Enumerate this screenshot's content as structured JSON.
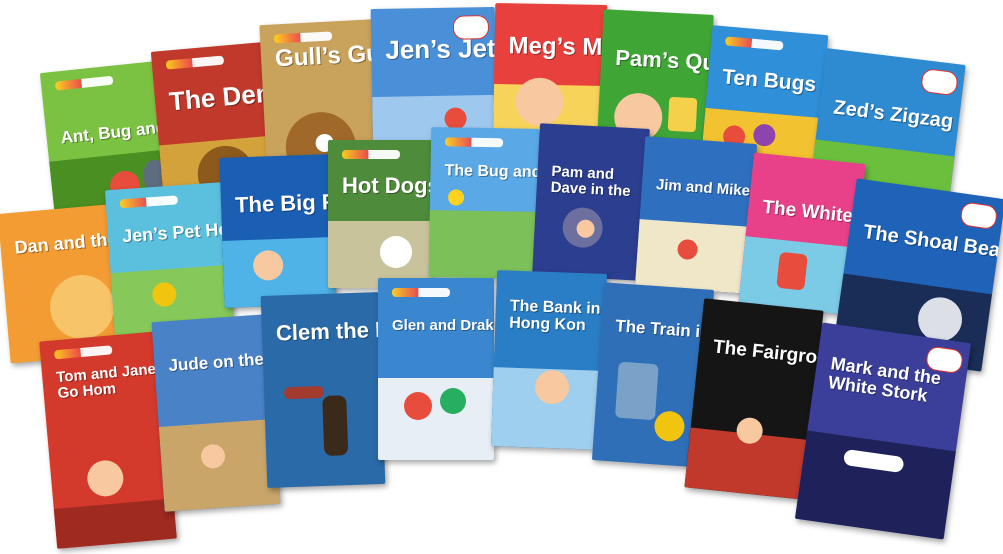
{
  "books": [
    {
      "key": "ant-bug",
      "title": "Ant, Bug and C",
      "bg": "#7cc242",
      "accent": "#4a8f21"
    },
    {
      "key": "the-den",
      "title": "The Den",
      "bg": "#c0392b",
      "accent": "#8d2a1e"
    },
    {
      "key": "gulls-gum",
      "title": "Gull’s Gu",
      "bg": "#c9a25c",
      "accent": "#8e6a31"
    },
    {
      "key": "jens-jet",
      "title": "Jen’s Jet",
      "bg": "#4a90d9",
      "accent": "#9fc8ee"
    },
    {
      "key": "megs-map",
      "title": "Meg’s Ma",
      "bg": "#e8403c",
      "accent": "#f7d35a"
    },
    {
      "key": "pams-quiz",
      "title": "Pam’s Qui",
      "bg": "#3fa535",
      "accent": "#f5d04a"
    },
    {
      "key": "ten-bugs",
      "title": "Ten Bugs",
      "bg": "#2f8fd8",
      "accent": "#f2c230"
    },
    {
      "key": "zeds-zigzag",
      "title": "Zed’s Zigzag",
      "bg": "#2e8bd2",
      "accent": "#6bbf3c"
    },
    {
      "key": "dan-and-the",
      "title": "Dan and the R",
      "bg": "#f39c33",
      "accent": "#f7c46a"
    },
    {
      "key": "jens-pet",
      "title": "Jen’s Pet He",
      "bg": "#5bc0de",
      "accent": "#86c95a"
    },
    {
      "key": "the-big-fish",
      "title": "The Big Fi",
      "bg": "#1b5fb4",
      "accent": "#4fb3e8"
    },
    {
      "key": "hot-dogs",
      "title": "Hot Dogs",
      "bg": "#4e8b3a",
      "accent": "#c8c39a"
    },
    {
      "key": "the-bug-and",
      "title": "The Bug and the",
      "bg": "#5aa9e6",
      "accent": "#7cc05a"
    },
    {
      "key": "pam-and-dave",
      "title": "Pam and Dave in the",
      "bg": "#2c3e8f",
      "accent": "#6d6f9e"
    },
    {
      "key": "jim-and-mike",
      "title": "Jim and Mike’s Ti",
      "bg": "#2f6fbf",
      "accent": "#f0e6c8"
    },
    {
      "key": "the-white-fish",
      "title": "The White Fis",
      "bg": "#e8418a",
      "accent": "#7ccbe6"
    },
    {
      "key": "the-shoal-beast",
      "title": "The Shoal Beast",
      "bg": "#1e63b8",
      "accent": "#1a2d57"
    },
    {
      "key": "tom-and-jane",
      "title": "Tom and Jane Go Hom",
      "bg": "#d33a2c",
      "accent": "#9e2a20"
    },
    {
      "key": "jude-on-the",
      "title": "Jude on the Du",
      "bg": "#4a82c8",
      "accent": "#c9a56a"
    },
    {
      "key": "clem-the",
      "title": "Clem the Br",
      "bg": "#2a6aa8",
      "accent": "#a33a2e"
    },
    {
      "key": "glen-and-drake",
      "title": "Glen and Drake’s Tri",
      "bg": "#3a86cf",
      "accent": "#e7eef6"
    },
    {
      "key": "the-bank",
      "title": "The Bank in Hong Kon",
      "bg": "#2a7ec6",
      "accent": "#9ecfee"
    },
    {
      "key": "the-train",
      "title": "The Train in Sp",
      "bg": "#2f6fb8",
      "accent": "#7aa2c8"
    },
    {
      "key": "the-fairground",
      "title": "The Fairground",
      "bg": "#151515",
      "accent": "#c0392b"
    },
    {
      "key": "mark-and-stork",
      "title": "Mark and the White Stork",
      "bg": "#3b3f9a",
      "accent": "#1f215a"
    }
  ]
}
